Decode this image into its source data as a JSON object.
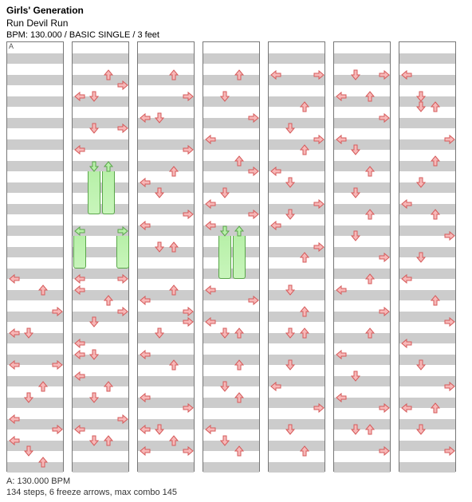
{
  "header": {
    "artist": "Girls' Generation",
    "title": "Run Devil Run",
    "meta": "BPM: 130.000 / BASIC SINGLE / 3 feet"
  },
  "footer": {
    "bpm_legend": "A: 130.000 BPM",
    "stats": "134 steps, 6 freeze arrows, max combo 145"
  },
  "layout": {
    "columns": 7,
    "lanes": [
      "L",
      "D",
      "U",
      "R"
    ],
    "lane_x": {
      "L": 9,
      "D": 27,
      "U": 45,
      "R": 63
    },
    "row_h": 13.5,
    "rows": 40,
    "marker": "A"
  },
  "holds": [
    {
      "c": 1,
      "lane": "D",
      "row": 12,
      "len": 4
    },
    {
      "c": 1,
      "lane": "U",
      "row": 12,
      "len": 4
    },
    {
      "c": 1,
      "lane": "L",
      "row": 18,
      "len": 3
    },
    {
      "c": 1,
      "lane": "R",
      "row": 18,
      "len": 3
    },
    {
      "c": 3,
      "lane": "D",
      "row": 18,
      "len": 4
    },
    {
      "c": 3,
      "lane": "U",
      "row": 18,
      "len": 4
    }
  ],
  "steps": [
    {
      "c": 0,
      "r": 22,
      "d": "L"
    },
    {
      "c": 0,
      "r": 23,
      "d": "U"
    },
    {
      "c": 0,
      "r": 25,
      "d": "R"
    },
    {
      "c": 0,
      "r": 27,
      "d": "L"
    },
    {
      "c": 0,
      "r": 27,
      "d": "D"
    },
    {
      "c": 0,
      "r": 30,
      "d": "L"
    },
    {
      "c": 0,
      "r": 30,
      "d": "R"
    },
    {
      "c": 0,
      "r": 32,
      "d": "U"
    },
    {
      "c": 0,
      "r": 33,
      "d": "D"
    },
    {
      "c": 0,
      "r": 35,
      "d": "L"
    },
    {
      "c": 0,
      "r": 36,
      "d": "R"
    },
    {
      "c": 0,
      "r": 37,
      "d": "L"
    },
    {
      "c": 0,
      "r": 38,
      "d": "D"
    },
    {
      "c": 0,
      "r": 39,
      "d": "U"
    },
    {
      "c": 1,
      "r": 3,
      "d": "U"
    },
    {
      "c": 1,
      "r": 4,
      "d": "R"
    },
    {
      "c": 1,
      "r": 5,
      "d": "L"
    },
    {
      "c": 1,
      "r": 5,
      "d": "D"
    },
    {
      "c": 1,
      "r": 8,
      "d": "D"
    },
    {
      "c": 1,
      "r": 8,
      "d": "R"
    },
    {
      "c": 1,
      "r": 10,
      "d": "L"
    },
    {
      "c": 1,
      "r": 22,
      "d": "L"
    },
    {
      "c": 1,
      "r": 22,
      "d": "R"
    },
    {
      "c": 1,
      "r": 23,
      "d": "L"
    },
    {
      "c": 1,
      "r": 24,
      "d": "U"
    },
    {
      "c": 1,
      "r": 25,
      "d": "R"
    },
    {
      "c": 1,
      "r": 26,
      "d": "D"
    },
    {
      "c": 1,
      "r": 28,
      "d": "L"
    },
    {
      "c": 1,
      "r": 29,
      "d": "L"
    },
    {
      "c": 1,
      "r": 29,
      "d": "D"
    },
    {
      "c": 1,
      "r": 31,
      "d": "L"
    },
    {
      "c": 1,
      "r": 32,
      "d": "U"
    },
    {
      "c": 1,
      "r": 33,
      "d": "D"
    },
    {
      "c": 1,
      "r": 35,
      "d": "R"
    },
    {
      "c": 1,
      "r": 36,
      "d": "L"
    },
    {
      "c": 1,
      "r": 37,
      "d": "D"
    },
    {
      "c": 1,
      "r": 37,
      "d": "U"
    },
    {
      "c": 2,
      "r": 3,
      "d": "U"
    },
    {
      "c": 2,
      "r": 5,
      "d": "R"
    },
    {
      "c": 2,
      "r": 7,
      "d": "L"
    },
    {
      "c": 2,
      "r": 7,
      "d": "D"
    },
    {
      "c": 2,
      "r": 10,
      "d": "R"
    },
    {
      "c": 2,
      "r": 12,
      "d": "U"
    },
    {
      "c": 2,
      "r": 13,
      "d": "L"
    },
    {
      "c": 2,
      "r": 14,
      "d": "D"
    },
    {
      "c": 2,
      "r": 16,
      "d": "R"
    },
    {
      "c": 2,
      "r": 17,
      "d": "L"
    },
    {
      "c": 2,
      "r": 19,
      "d": "D"
    },
    {
      "c": 2,
      "r": 19,
      "d": "U"
    },
    {
      "c": 2,
      "r": 23,
      "d": "U"
    },
    {
      "c": 2,
      "r": 24,
      "d": "L"
    },
    {
      "c": 2,
      "r": 25,
      "d": "R"
    },
    {
      "c": 2,
      "r": 26,
      "d": "R"
    },
    {
      "c": 2,
      "r": 27,
      "d": "D"
    },
    {
      "c": 2,
      "r": 29,
      "d": "L"
    },
    {
      "c": 2,
      "r": 30,
      "d": "U"
    },
    {
      "c": 2,
      "r": 33,
      "d": "L"
    },
    {
      "c": 2,
      "r": 34,
      "d": "R"
    },
    {
      "c": 2,
      "r": 36,
      "d": "L"
    },
    {
      "c": 2,
      "r": 36,
      "d": "D"
    },
    {
      "c": 2,
      "r": 37,
      "d": "U"
    },
    {
      "c": 2,
      "r": 38,
      "d": "L"
    },
    {
      "c": 2,
      "r": 38,
      "d": "R"
    },
    {
      "c": 3,
      "r": 3,
      "d": "U"
    },
    {
      "c": 3,
      "r": 5,
      "d": "D"
    },
    {
      "c": 3,
      "r": 7,
      "d": "R"
    },
    {
      "c": 3,
      "r": 9,
      "d": "L"
    },
    {
      "c": 3,
      "r": 11,
      "d": "U"
    },
    {
      "c": 3,
      "r": 12,
      "d": "R"
    },
    {
      "c": 3,
      "r": 14,
      "d": "D"
    },
    {
      "c": 3,
      "r": 15,
      "d": "L"
    },
    {
      "c": 3,
      "r": 16,
      "d": "R"
    },
    {
      "c": 3,
      "r": 17,
      "d": "L"
    },
    {
      "c": 3,
      "r": 23,
      "d": "L"
    },
    {
      "c": 3,
      "r": 24,
      "d": "R"
    },
    {
      "c": 3,
      "r": 26,
      "d": "L"
    },
    {
      "c": 3,
      "r": 27,
      "d": "D"
    },
    {
      "c": 3,
      "r": 27,
      "d": "U"
    },
    {
      "c": 3,
      "r": 30,
      "d": "U"
    },
    {
      "c": 3,
      "r": 32,
      "d": "D"
    },
    {
      "c": 3,
      "r": 33,
      "d": "U"
    },
    {
      "c": 3,
      "r": 36,
      "d": "L"
    },
    {
      "c": 3,
      "r": 37,
      "d": "D"
    },
    {
      "c": 3,
      "r": 38,
      "d": "U"
    },
    {
      "c": 4,
      "r": 3,
      "d": "L"
    },
    {
      "c": 4,
      "r": 3,
      "d": "R"
    },
    {
      "c": 4,
      "r": 6,
      "d": "U"
    },
    {
      "c": 4,
      "r": 8,
      "d": "D"
    },
    {
      "c": 4,
      "r": 9,
      "d": "R"
    },
    {
      "c": 4,
      "r": 10,
      "d": "U"
    },
    {
      "c": 4,
      "r": 12,
      "d": "L"
    },
    {
      "c": 4,
      "r": 13,
      "d": "D"
    },
    {
      "c": 4,
      "r": 15,
      "d": "R"
    },
    {
      "c": 4,
      "r": 16,
      "d": "D"
    },
    {
      "c": 4,
      "r": 17,
      "d": "L"
    },
    {
      "c": 4,
      "r": 19,
      "d": "R"
    },
    {
      "c": 4,
      "r": 20,
      "d": "U"
    },
    {
      "c": 4,
      "r": 23,
      "d": "D"
    },
    {
      "c": 4,
      "r": 25,
      "d": "U"
    },
    {
      "c": 4,
      "r": 27,
      "d": "D"
    },
    {
      "c": 4,
      "r": 27,
      "d": "U"
    },
    {
      "c": 4,
      "r": 30,
      "d": "D"
    },
    {
      "c": 4,
      "r": 32,
      "d": "L"
    },
    {
      "c": 4,
      "r": 34,
      "d": "R"
    },
    {
      "c": 4,
      "r": 36,
      "d": "D"
    },
    {
      "c": 4,
      "r": 38,
      "d": "U"
    },
    {
      "c": 5,
      "r": 3,
      "d": "D"
    },
    {
      "c": 5,
      "r": 3,
      "d": "R"
    },
    {
      "c": 5,
      "r": 5,
      "d": "L"
    },
    {
      "c": 5,
      "r": 5,
      "d": "U"
    },
    {
      "c": 5,
      "r": 7,
      "d": "R"
    },
    {
      "c": 5,
      "r": 9,
      "d": "L"
    },
    {
      "c": 5,
      "r": 10,
      "d": "D"
    },
    {
      "c": 5,
      "r": 12,
      "d": "U"
    },
    {
      "c": 5,
      "r": 14,
      "d": "D"
    },
    {
      "c": 5,
      "r": 16,
      "d": "U"
    },
    {
      "c": 5,
      "r": 18,
      "d": "D"
    },
    {
      "c": 5,
      "r": 20,
      "d": "R"
    },
    {
      "c": 5,
      "r": 22,
      "d": "U"
    },
    {
      "c": 5,
      "r": 23,
      "d": "L"
    },
    {
      "c": 5,
      "r": 25,
      "d": "R"
    },
    {
      "c": 5,
      "r": 27,
      "d": "U"
    },
    {
      "c": 5,
      "r": 29,
      "d": "L"
    },
    {
      "c": 5,
      "r": 31,
      "d": "D"
    },
    {
      "c": 5,
      "r": 33,
      "d": "L"
    },
    {
      "c": 5,
      "r": 34,
      "d": "R"
    },
    {
      "c": 5,
      "r": 36,
      "d": "D"
    },
    {
      "c": 5,
      "r": 36,
      "d": "U"
    },
    {
      "c": 5,
      "r": 38,
      "d": "R"
    },
    {
      "c": 6,
      "r": 3,
      "d": "L"
    },
    {
      "c": 6,
      "r": 5,
      "d": "D"
    },
    {
      "c": 6,
      "r": 6,
      "d": "D"
    },
    {
      "c": 6,
      "r": 6,
      "d": "U"
    },
    {
      "c": 6,
      "r": 9,
      "d": "R"
    },
    {
      "c": 6,
      "r": 11,
      "d": "U"
    },
    {
      "c": 6,
      "r": 13,
      "d": "D"
    },
    {
      "c": 6,
      "r": 15,
      "d": "L"
    },
    {
      "c": 6,
      "r": 16,
      "d": "U"
    },
    {
      "c": 6,
      "r": 18,
      "d": "R"
    },
    {
      "c": 6,
      "r": 20,
      "d": "D"
    },
    {
      "c": 6,
      "r": 22,
      "d": "L"
    },
    {
      "c": 6,
      "r": 24,
      "d": "U"
    },
    {
      "c": 6,
      "r": 26,
      "d": "R"
    },
    {
      "c": 6,
      "r": 28,
      "d": "L"
    },
    {
      "c": 6,
      "r": 30,
      "d": "D"
    },
    {
      "c": 6,
      "r": 32,
      "d": "R"
    },
    {
      "c": 6,
      "r": 34,
      "d": "L"
    },
    {
      "c": 6,
      "r": 34,
      "d": "U"
    },
    {
      "c": 6,
      "r": 36,
      "d": "D"
    },
    {
      "c": 6,
      "r": 38,
      "d": "R"
    }
  ]
}
